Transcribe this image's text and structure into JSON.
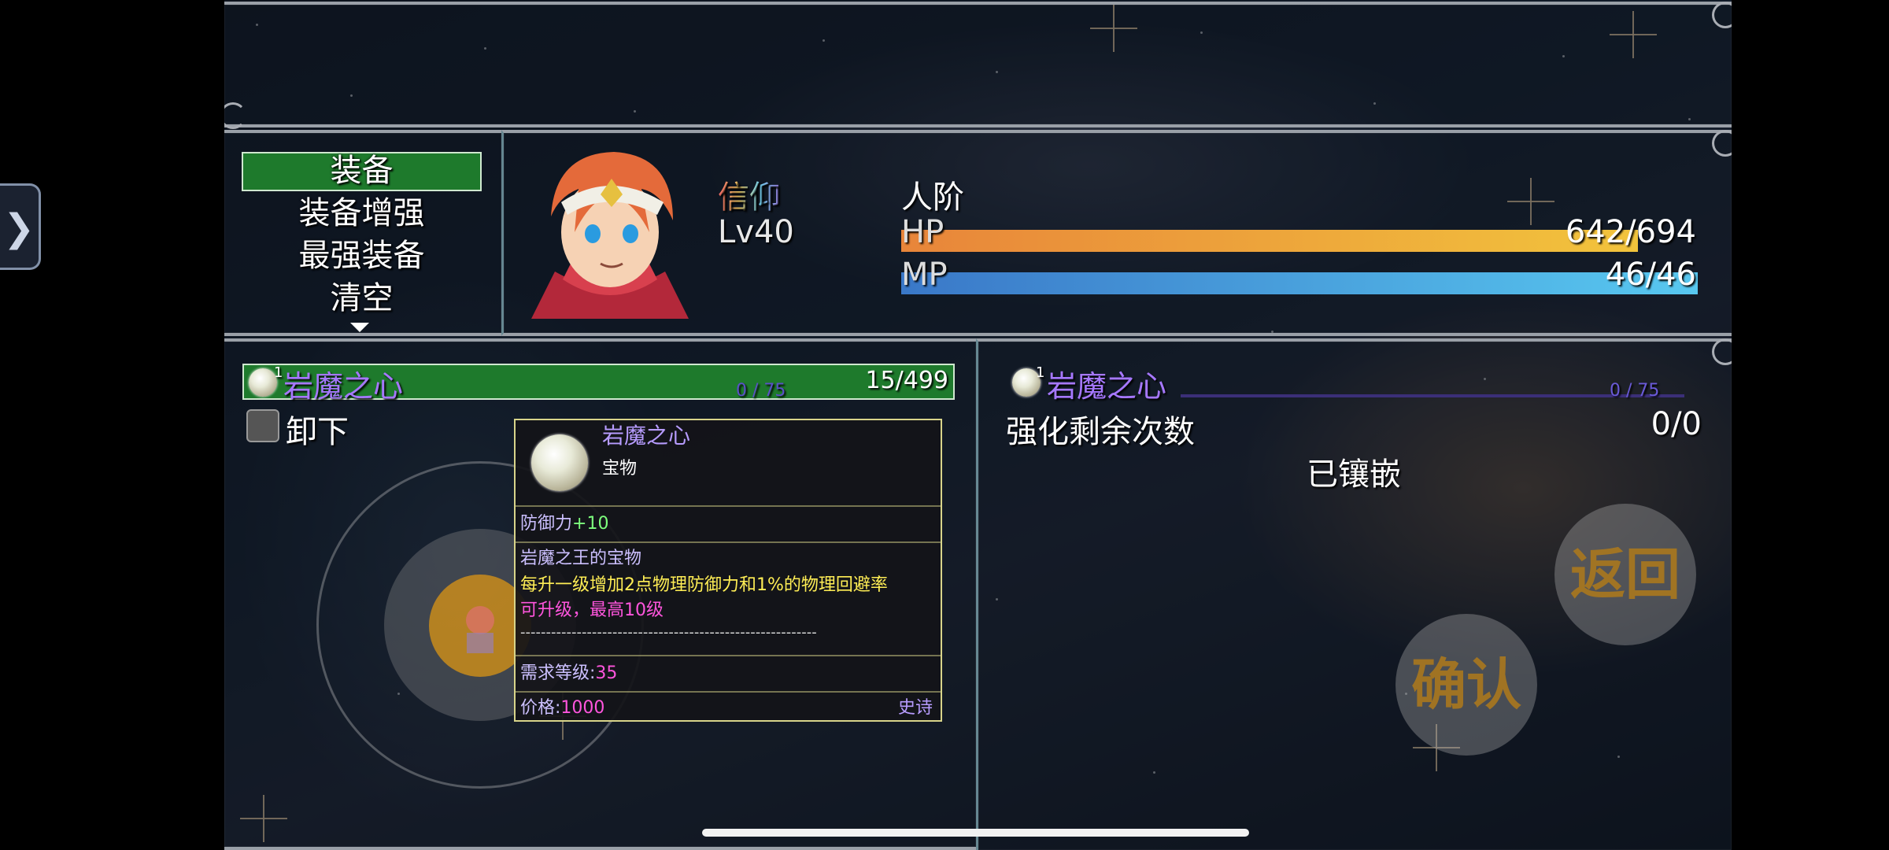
{
  "side_tab": {
    "icon": "chevron-right-icon",
    "glyph": "❯"
  },
  "menu": {
    "items": [
      {
        "label": "装备",
        "selected": true
      },
      {
        "label": "装备增强",
        "selected": false
      },
      {
        "label": "最强装备",
        "selected": false
      },
      {
        "label": "清空",
        "selected": false
      }
    ],
    "more_icon": "triangle-down-icon"
  },
  "actor": {
    "name": "信仰",
    "level": "Lv40",
    "class": "人阶",
    "hp_label": "HP",
    "hp_value": "642/694",
    "hp_fraction": 0.925,
    "mp_label": "MP",
    "mp_value": "46/46",
    "mp_fraction": 1.0
  },
  "left_panel": {
    "slot": {
      "count": "1",
      "name": "岩魔之心",
      "exp": "0 / 75",
      "value": "15/499"
    },
    "unequip_label": "卸下"
  },
  "tooltip": {
    "name": "岩魔之心",
    "type": "宝物",
    "defense_label": "防御力",
    "defense_value": "+10",
    "desc_title": "岩魔之王的宝物",
    "desc_effect": "每升一级增加2点物理防御力和1%的物理回避率",
    "desc_upgrade": "可升级，最高10级",
    "separator": "----------------------------------------------------------",
    "req_label": "需求等级:",
    "req_value": "35",
    "price_label": "价格:",
    "price_value": "1000",
    "rarity": "史诗"
  },
  "right_panel": {
    "slot": {
      "count": "1",
      "name": "岩魔之心",
      "exp": "0 / 75"
    },
    "enhance_label": "强化剩余次数",
    "enhance_value": "0/0",
    "status": "已镶嵌"
  },
  "buttons": {
    "back": "返回",
    "confirm": "确认"
  },
  "colors": {
    "menu_select": "#1e7a2c",
    "name_purple": "#a678ff",
    "hp_bar": [
      "#e8853a",
      "#f2c43c"
    ],
    "mp_bar": [
      "#3a78c8",
      "#58c8f0"
    ],
    "tooltip_border": "#d8d48a",
    "defense_green": "#7dff7d",
    "effect_yellow": "#ffee55",
    "magenta": "#ff55dd"
  }
}
